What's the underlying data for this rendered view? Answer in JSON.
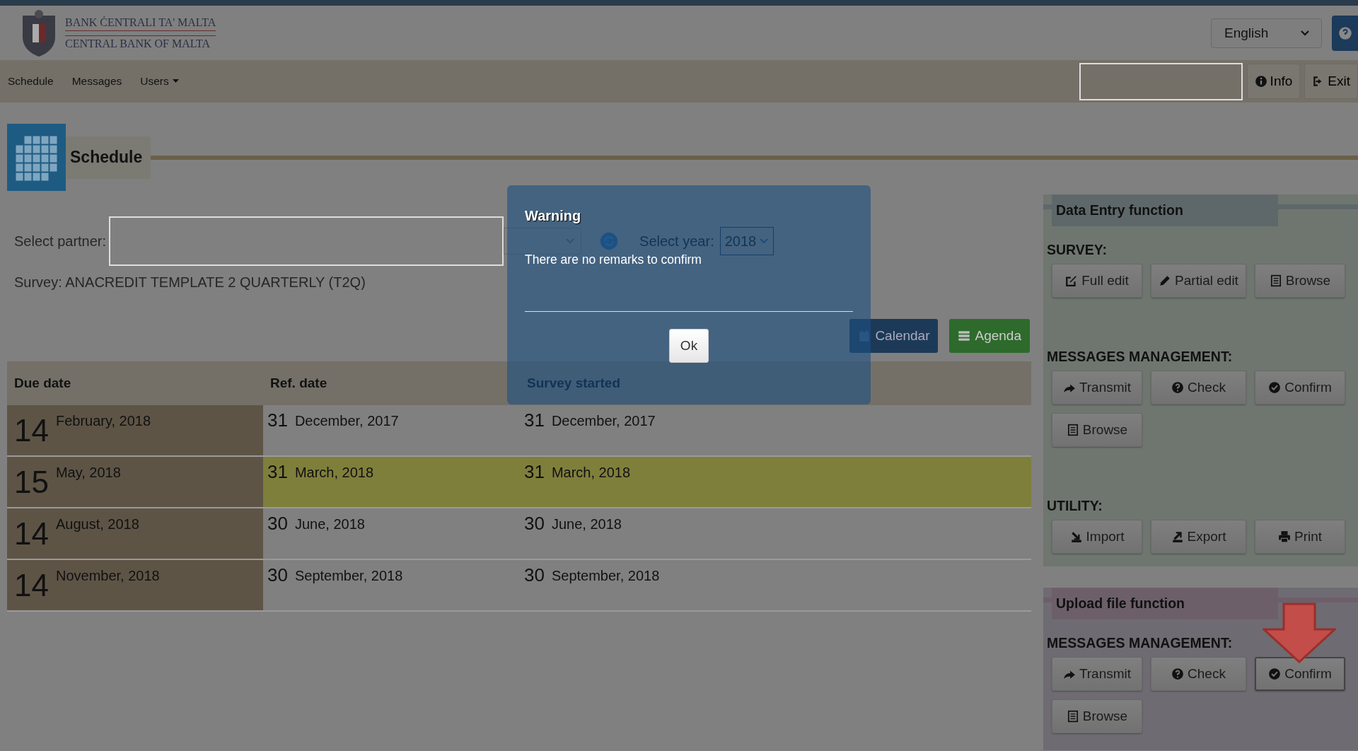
{
  "header": {
    "logo_top": "BANK ĊENTRALI TA' MALTA",
    "logo_bottom": "CENTRAL BANK OF MALTA",
    "language": "English"
  },
  "nav": [
    {
      "label": "Schedule",
      "menu": false
    },
    {
      "label": "Messages",
      "menu": false
    },
    {
      "label": "Users",
      "menu": true
    }
  ],
  "toolbar": [
    {
      "label": "Info",
      "kind": "info"
    },
    {
      "label": "Exit",
      "kind": "exit"
    }
  ],
  "page_title": "Schedule",
  "form": {
    "partner_label": "Select partner:",
    "year_label": "Select year:",
    "year": "2018",
    "survey": "Survey: ANACREDIT TEMPLATE 2 QUARTERLY (T2Q)"
  },
  "view_buttons": [
    {
      "label": "Calendar",
      "kind": "calendar"
    },
    {
      "label": "Agenda",
      "kind": "agenda"
    }
  ],
  "table": {
    "columns": [
      "Due date",
      "Ref. date",
      "Survey started"
    ],
    "rows": [
      {
        "selected": false,
        "due": {
          "day": "14",
          "month": "February, 2018"
        },
        "ref": {
          "day": "31",
          "month": "December, 2017"
        },
        "started": {
          "day": "31",
          "month": "December, 2017"
        }
      },
      {
        "selected": true,
        "due": {
          "day": "15",
          "month": "May, 2018"
        },
        "ref": {
          "day": "31",
          "month": "March, 2018"
        },
        "started": {
          "day": "31",
          "month": "March, 2018"
        }
      },
      {
        "selected": false,
        "due": {
          "day": "14",
          "month": "August, 2018"
        },
        "ref": {
          "day": "30",
          "month": "June, 2018"
        },
        "started": {
          "day": "30",
          "month": "June, 2018"
        }
      },
      {
        "selected": false,
        "due": {
          "day": "14",
          "month": "November, 2018"
        },
        "ref": {
          "day": "30",
          "month": "September, 2018"
        },
        "started": {
          "day": "30",
          "month": "September, 2018"
        }
      }
    ]
  },
  "panels": [
    {
      "title": "Data Entry function",
      "color": "#5e686b",
      "groups": [
        {
          "heading": "SURVEY:",
          "buttons": [
            {
              "label": "Full edit",
              "kind": "edit",
              "focused": false
            },
            {
              "label": "Partial edit",
              "kind": "pencil",
              "focused": false
            },
            {
              "label": "Browse",
              "kind": "list",
              "focused": false
            }
          ]
        },
        {
          "heading": "MESSAGES MANAGEMENT:",
          "buttons": [
            {
              "label": "Transmit",
              "kind": "share",
              "focused": false
            },
            {
              "label": "Check",
              "kind": "help",
              "focused": false
            },
            {
              "label": "Confirm",
              "kind": "confirm",
              "focused": false
            },
            {
              "label": "Browse",
              "kind": "list",
              "focused": false
            }
          ]
        },
        {
          "heading": "UTILITY:",
          "buttons": [
            {
              "label": "Import",
              "kind": "import",
              "focused": false
            },
            {
              "label": "Export",
              "kind": "export",
              "focused": false
            },
            {
              "label": "Print",
              "kind": "print",
              "focused": false
            }
          ]
        }
      ]
    },
    {
      "title": "Upload file function",
      "color": "#6d5f6a",
      "groups": [
        {
          "heading": "MESSAGES MANAGEMENT:",
          "buttons": [
            {
              "label": "Transmit",
              "kind": "share",
              "focused": false
            },
            {
              "label": "Check",
              "kind": "help",
              "focused": false
            },
            {
              "label": "Confirm",
              "kind": "confirm",
              "focused": true
            },
            {
              "label": "Browse",
              "kind": "list",
              "focused": false
            }
          ]
        }
      ]
    }
  ],
  "dialog": {
    "title": "Warning",
    "message": "There are no remarks to confirm",
    "button": "Ok"
  }
}
